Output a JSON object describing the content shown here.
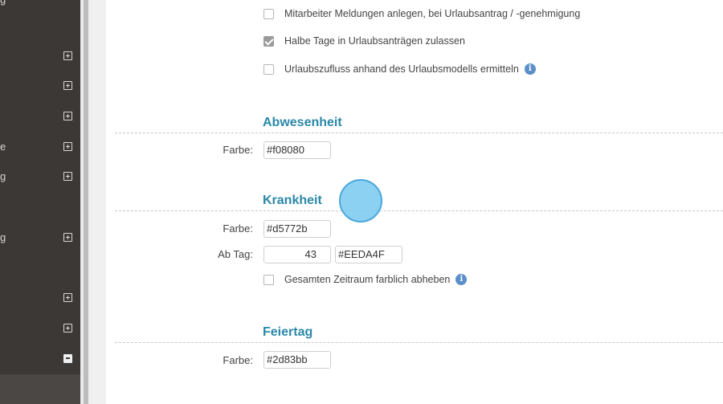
{
  "sidebar": {
    "items": [
      {
        "label": "g",
        "toggle": "none"
      },
      {
        "label": "",
        "toggle": "plus"
      },
      {
        "label": "",
        "toggle": "plus"
      },
      {
        "label": "",
        "toggle": "plus"
      },
      {
        "label": "e",
        "toggle": "plus"
      },
      {
        "label": "g",
        "toggle": "plus"
      },
      {
        "label": "g",
        "toggle": "plus"
      },
      {
        "label": "",
        "toggle": "plus"
      },
      {
        "label": "",
        "toggle": "plus"
      },
      {
        "label": "",
        "toggle": "minus"
      }
    ]
  },
  "options": {
    "mitarbeiter_meldungen": {
      "label": "Mitarbeiter Meldungen anlegen, bei Urlaubsantrag / -genehmigung",
      "checked": false
    },
    "halbe_tage": {
      "label": "Halbe Tage in Urlaubsanträgen zulassen",
      "checked": true
    },
    "urlaubszufluss": {
      "label": "Urlaubszufluss anhand des Urlaubsmodells ermitteln",
      "checked": false,
      "info": "i"
    }
  },
  "abwesenheit": {
    "title": "Abwesenheit",
    "farbe_label": "Farbe:",
    "farbe_value": "#f08080"
  },
  "krankheit": {
    "title": "Krankheit",
    "farbe_label": "Farbe:",
    "farbe_value": "#d5772b",
    "ab_tag_label": "Ab Tag:",
    "ab_tag_value": "43",
    "ab_tag_color": "#EEDA4F",
    "gesamten_zeitraum": {
      "label": "Gesamten Zeitraum farblich abheben",
      "checked": false,
      "info": "i"
    }
  },
  "feiertag": {
    "title": "Feiertag",
    "farbe_label": "Farbe:",
    "farbe_value": "#2d83bb"
  },
  "colors": {
    "accent": "#2a88a8",
    "sidebar_bg": "#3b3836"
  }
}
